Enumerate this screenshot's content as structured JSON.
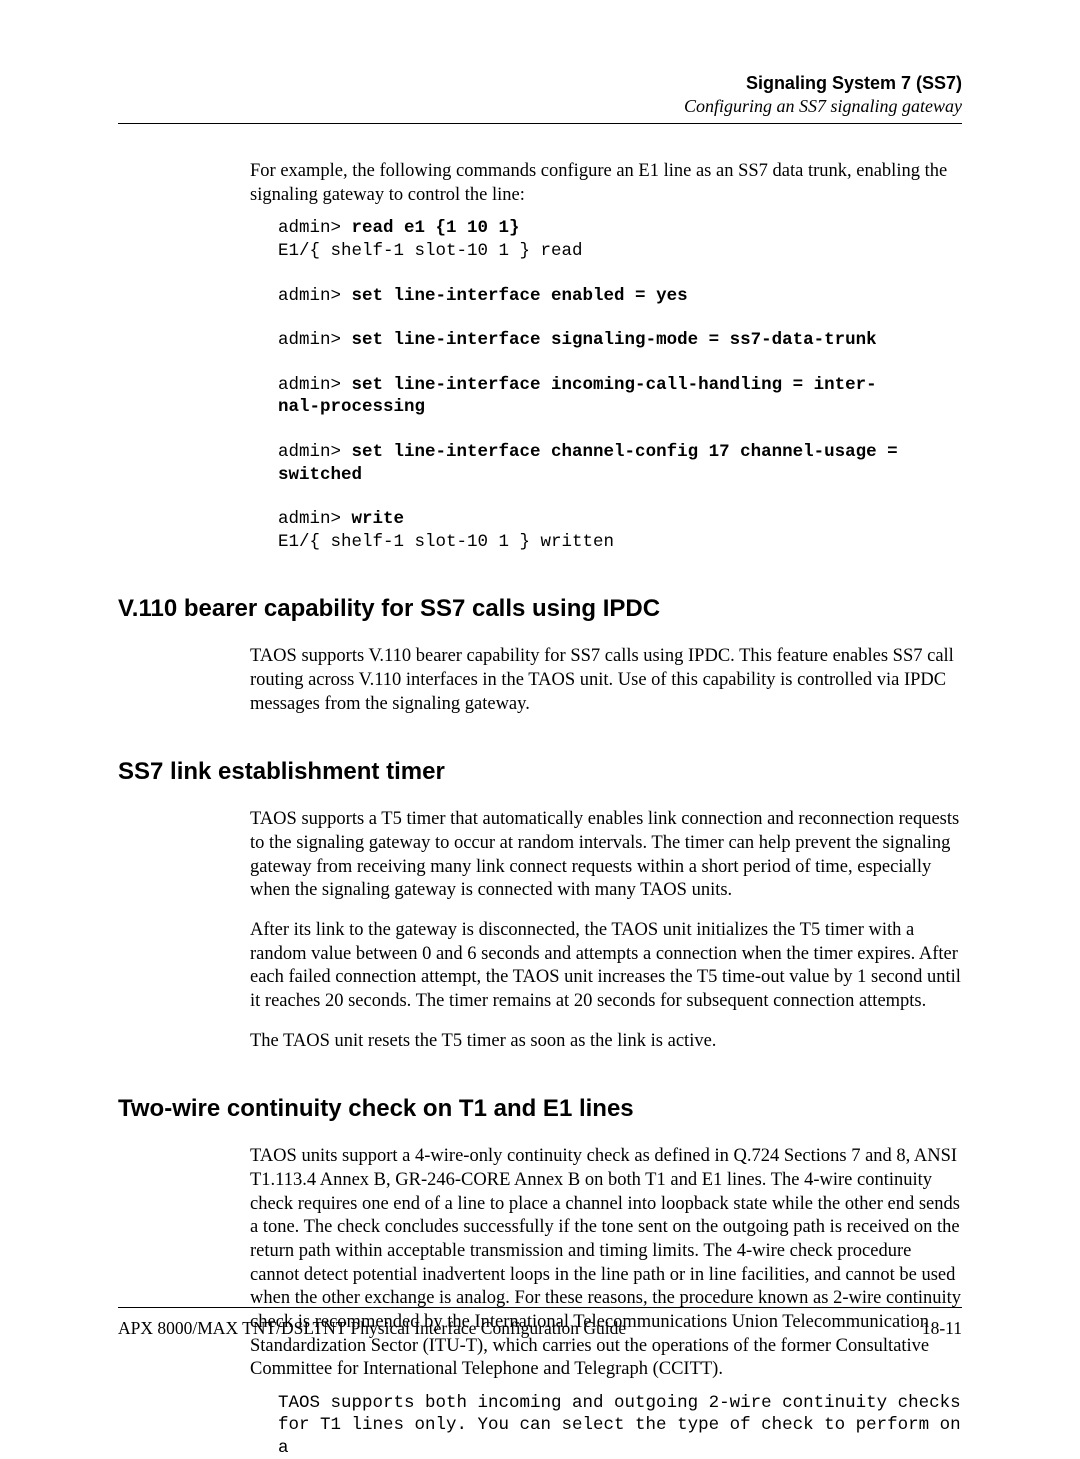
{
  "header": {
    "title": "Signaling System 7 (SS7)",
    "subtitle": "Configuring an SS7 signaling gateway"
  },
  "intro": "For example, the following commands configure an E1 line as an SS7 data trunk, enabling the signaling gateway to control the line:",
  "code": {
    "l1a": "admin> ",
    "l1b": "read e1 {1 10 1}",
    "l2": "E1/{ shelf-1 slot-10 1 } read",
    "l3a": "admin> ",
    "l3b": "set line-interface enabled = yes",
    "l4a": "admin> ",
    "l4b": "set line-interface signaling-mode = ss7-data-trunk",
    "l5a": "admin> ",
    "l5b": "set line-interface incoming-call-handling = inter-",
    "l5c": "nal-processing",
    "l6a": "admin> ",
    "l6b": "set line-interface channel-config 17 channel-usage = ",
    "l6c": "switched",
    "l7a": "admin> ",
    "l7b": "write",
    "l8": "E1/{ shelf-1 slot-10 1 } written"
  },
  "sections": {
    "s1": {
      "heading": "V.110 bearer capability for SS7 calls using IPDC",
      "p1": "TAOS supports V.110 bearer capability for SS7 calls using IPDC. This feature enables SS7 call routing across V.110 interfaces in the TAOS unit. Use of this capability is controlled via IPDC messages from the signaling gateway."
    },
    "s2": {
      "heading": "SS7 link establishment timer",
      "p1": "TAOS supports a T5 timer that automatically enables link connection and reconnection requests to the signaling gateway to occur at random intervals. The timer can help prevent the signaling gateway from receiving many link connect requests within a short period of time, especially when the signaling gateway is connected with many TAOS units.",
      "p2": "After its link to the gateway is disconnected, the TAOS unit initializes the T5 timer with a random value between 0 and 6 seconds and attempts a connection when the timer expires. After each failed connection attempt, the TAOS unit increases the T5 time-out value by 1 second until it reaches 20 seconds. The timer remains at 20 seconds for subsequent connection attempts.",
      "p3": "The TAOS unit resets the T5 timer as soon as the link is active."
    },
    "s3": {
      "heading": "Two-wire continuity check on T1 and E1 lines",
      "p1": "TAOS units support a 4-wire-only continuity check as defined in Q.724 Sections 7 and 8, ANSI T1.113.4 Annex B, GR-246-CORE Annex B on both T1 and E1 lines. The 4-wire continuity check requires one end of a line to place a channel into loopback state while the other end sends a tone. The check concludes successfully if the tone sent on the outgoing path is received on the return path within acceptable transmission and timing limits. The 4-wire check procedure cannot detect potential inadvertent loops in the line path or in line facilities, and cannot be used when the other exchange is analog. For these reasons, the procedure known as 2-wire continuity check is recommended by the International Telecommunications Union Telecommunication Standardization Sector (ITU-T), which carries out the operations of the former Consultative Committee for International Telephone and Telegraph (CCITT).",
      "code1": "TAOS supports both incoming and outgoing 2-wire continuity checks ",
      "code2": "for T1 lines only. You can select the type of check to perform on a "
    }
  },
  "footer": {
    "left": "APX 8000/MAX TNT/DSLTNT Physical Interface Configuration Guide",
    "right": "18-11"
  }
}
